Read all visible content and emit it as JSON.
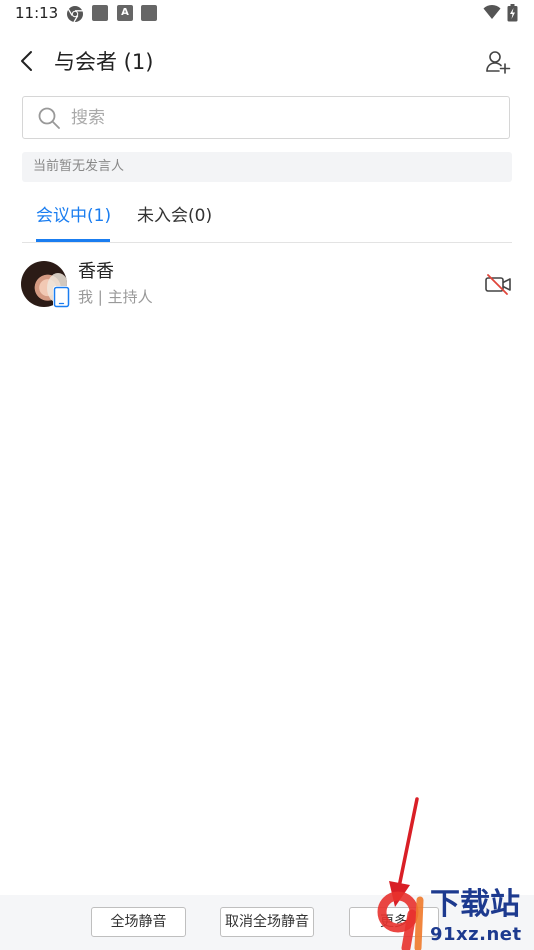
{
  "status_bar": {
    "time": "11:13",
    "notification_icons": [
      "chrome-icon",
      "app-square-icon",
      "a-app-icon",
      "app-square-icon"
    ],
    "a_label": "A",
    "system_icons": [
      "wifi-icon",
      "battery-charging-icon"
    ]
  },
  "header": {
    "title": "与会者 (1)",
    "back_icon": "chevron-left-icon",
    "add_icon": "add-person-icon"
  },
  "search": {
    "placeholder": "搜索",
    "value": ""
  },
  "notice": {
    "text": "当前暂无发言人"
  },
  "tabs": [
    {
      "label": "会议中(1)",
      "active": true
    },
    {
      "label": "未入会(0)",
      "active": false
    }
  ],
  "participants": [
    {
      "name": "香香",
      "role": "我 | 主持人",
      "device_icon": "phone-icon",
      "camera_icon": "camera-off-icon"
    }
  ],
  "bottom_bar": {
    "buttons": [
      {
        "label": "全场静音"
      },
      {
        "label": "取消全场静音"
      },
      {
        "label": "更多"
      }
    ]
  },
  "watermark": {
    "title": "下载站",
    "url": "91xz.net"
  },
  "colors": {
    "accent": "#1a7df0",
    "camera_off": "#e0453a",
    "arrow": "#d91f26",
    "watermark": "#1d3a8f"
  }
}
